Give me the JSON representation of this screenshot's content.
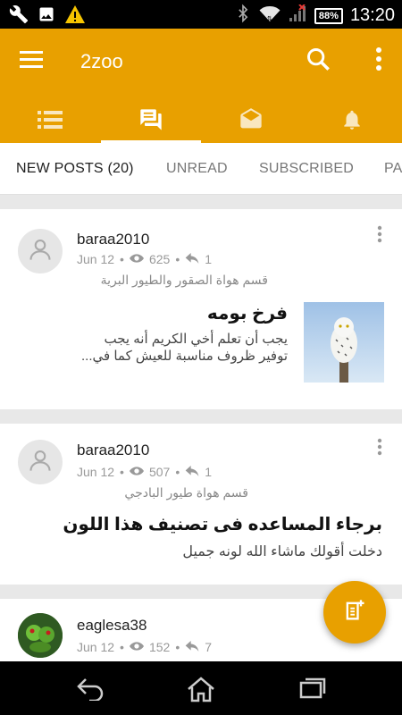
{
  "status": {
    "battery": "88%",
    "time": "13:20",
    "icons": [
      "wrench-icon",
      "image-icon",
      "warning-icon",
      "bluetooth-icon",
      "wifi-icon",
      "signal-icon",
      "battery-icon"
    ]
  },
  "appbar": {
    "title": "2zoo",
    "accent": "#E8A000",
    "tabs": [
      "list-icon",
      "forum-icon",
      "envelope-open-icon",
      "bell-icon"
    ],
    "active_tab": 1
  },
  "subtabs": {
    "items": [
      "NEW POSTS (20)",
      "UNREAD",
      "SUBSCRIBED",
      "PA"
    ],
    "active": 0
  },
  "posts": [
    {
      "user": "baraa2010",
      "date": "Jun 12",
      "views": "625",
      "replies": "1",
      "forum": "قسم هواة الصقور والطيور البرية",
      "title": "فرخ بومه",
      "excerpt_1": "يجب أن تعلم أخي الكريم أنه يجب",
      "excerpt_2": "توفير ظروف مناسبة للعيش كما في...",
      "has_thumb": true
    },
    {
      "user": "baraa2010",
      "date": "Jun 12",
      "views": "507",
      "replies": "1",
      "forum": "قسم هواة طيور البادجي",
      "title": "برجاء المساعده فى تصنيف هذا اللون",
      "excerpt_1": "دخلت أقولك ماشاء الله لونه جميل",
      "has_thumb": false
    },
    {
      "user": "eaglesa38",
      "date": "Jun 12",
      "views": "152",
      "replies": "7"
    }
  ]
}
